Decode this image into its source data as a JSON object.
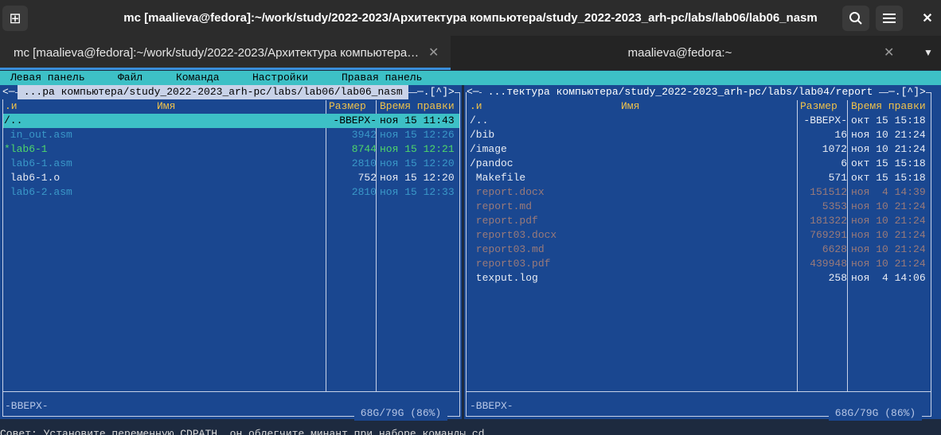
{
  "window": {
    "title": "mc [maalieva@fedora]:~/work/study/2022-2023/Архитектура компьютера/study_2022-2023_arh-pc/labs/lab06/lab06_nasm",
    "new_tab_icon": "⊞",
    "search_icon": "⌕",
    "menu_icon": "≡",
    "close_icon": "✕"
  },
  "tabs": [
    {
      "label": "mc [maalieva@fedora]:~/work/study/2022-2023/Архитектура компьютера…",
      "close": "✕"
    },
    {
      "label": "maalieva@fedora:~",
      "close": "✕",
      "dropdown": "▼"
    }
  ],
  "mc_menu": [
    "Левая панель",
    "Файл",
    "Команда",
    "Настройки",
    "Правая панель"
  ],
  "left_panel": {
    "path": " ...ра компьютера/study_2022-2023_arh-pc/labs/lab06/lab06_nasm ",
    "corner_left": "<─",
    "corner_right": "─.[^]>",
    "col_sort": ".и",
    "col_name": "Имя",
    "col_size": "Размер",
    "col_time": "Время правки",
    "rows": [
      {
        "name": "/..",
        "size": "-ВВЕРХ-",
        "time": "ноя 15 11:43",
        "kind": "selected"
      },
      {
        "name": " in_out.asm",
        "size": "3942",
        "time": "ноя 15 12:26",
        "kind": "asm"
      },
      {
        "name": "*lab6-1",
        "size": "8744",
        "time": "ноя 15 12:21",
        "kind": "exec"
      },
      {
        "name": " lab6-1.asm",
        "size": "2810",
        "time": "ноя 15 12:20",
        "kind": "asm"
      },
      {
        "name": " lab6-1.o",
        "size": "752",
        "time": "ноя 15 12:20",
        "kind": "plain"
      },
      {
        "name": " lab6-2.asm",
        "size": "2810",
        "time": "ноя 15 12:33",
        "kind": "asm"
      }
    ],
    "status": "-ВВЕРХ-",
    "free": " 68G/79G (86%) "
  },
  "right_panel": {
    "path": " ...тектура компьютера/study_2022-2023_arh-pc/labs/lab04/report ",
    "corner_left": "<─",
    "corner_right": "─.[^]>",
    "col_sort": ".и",
    "col_name": "Имя",
    "col_size": "Размер",
    "col_time": "Время правки",
    "rows": [
      {
        "name": "/..",
        "size": "-ВВЕРХ-",
        "time": "окт 15 15:18",
        "kind": "plain"
      },
      {
        "name": "/bib",
        "size": "16",
        "time": "ноя 10 21:24",
        "kind": "plain"
      },
      {
        "name": "/image",
        "size": "1072",
        "time": "ноя 10 21:24",
        "kind": "plain"
      },
      {
        "name": "/pandoc",
        "size": "6",
        "time": "окт 15 15:18",
        "kind": "plain"
      },
      {
        "name": " Makefile",
        "size": "571",
        "time": "окт 15 15:18",
        "kind": "plain"
      },
      {
        "name": " report.docx",
        "size": "151512",
        "time": "ноя  4 14:39",
        "kind": "doc"
      },
      {
        "name": " report.md",
        "size": "5353",
        "time": "ноя 10 21:24",
        "kind": "doc"
      },
      {
        "name": " report.pdf",
        "size": "181322",
        "time": "ноя 10 21:24",
        "kind": "doc"
      },
      {
        "name": " report03.docx",
        "size": "769291",
        "time": "ноя 10 21:24",
        "kind": "doc"
      },
      {
        "name": " report03.md",
        "size": "6628",
        "time": "ноя 10 21:24",
        "kind": "doc"
      },
      {
        "name": " report03.pdf",
        "size": "439948",
        "time": "ноя 10 21:24",
        "kind": "doc"
      },
      {
        "name": " texput.log",
        "size": "258",
        "time": "ноя  4 14:06",
        "kind": "plain"
      }
    ],
    "status": "-ВВЕРХ-",
    "free": " 68G/79G (86%) "
  },
  "hint_line": "Совет: Установите переменную CDPATH, он облегчите минант при наборе команды cd",
  "colors": {
    "panel_bg": "#1a4790",
    "menubar_bg": "#3dc0c6",
    "header_yellow": "#f0c24b",
    "exec_green": "#4fd66a",
    "asm_cyan": "#3a98c8",
    "doc_gray": "#9a7a7a",
    "accent_tab": "#3a8fdc"
  }
}
